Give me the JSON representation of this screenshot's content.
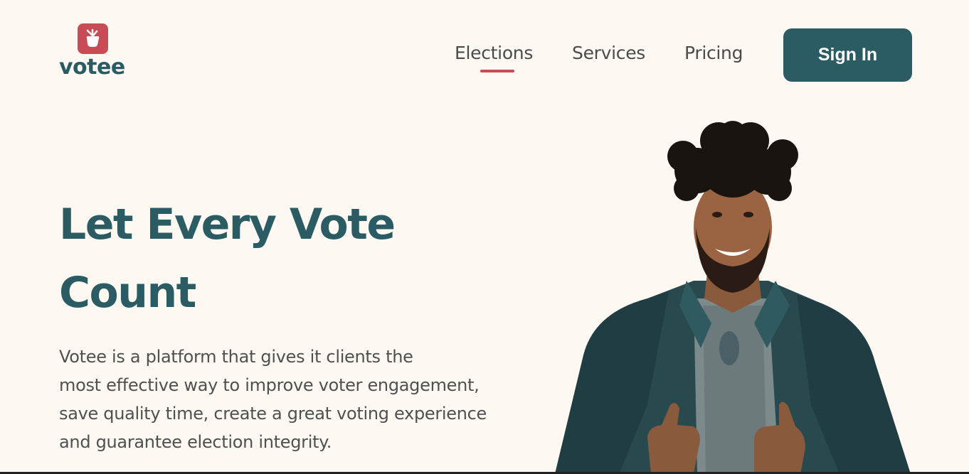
{
  "brand": {
    "name": "votee",
    "logo_icon": "hand-vote-icon",
    "accent": "#c94b55",
    "primary": "#2c5c63"
  },
  "nav": {
    "items": [
      {
        "label": "Elections",
        "active": true
      },
      {
        "label": "Services",
        "active": false
      },
      {
        "label": "Pricing",
        "active": false
      }
    ],
    "signin_label": "Sign In"
  },
  "hero": {
    "title_line1": "Let Every Vote",
    "title_line2": "Count",
    "desc_line1": "Votee is a platform that gives it clients the",
    "desc_line2": "most effective way to improve voter engagement,",
    "desc_line3": "save quality time, create a great voting experience",
    "desc_line4": "and guarantee election integrity."
  },
  "colors": {
    "background": "#fdf9f2",
    "text": "#505050"
  }
}
